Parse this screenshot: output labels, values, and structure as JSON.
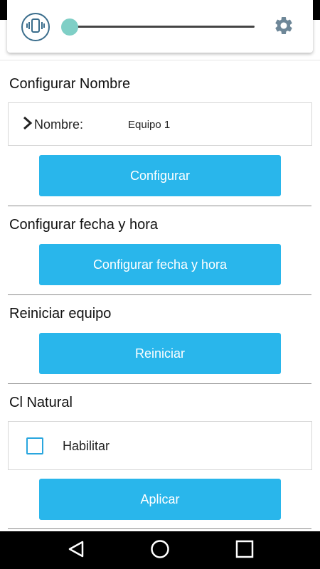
{
  "toolbar": {
    "volume": {
      "value": 0,
      "min": 0,
      "max": 100
    }
  },
  "sections": {
    "nombre": {
      "title": "Configurar Nombre",
      "field_label": "Nombre:",
      "field_value": "Equipo 1",
      "button_label": "Configurar"
    },
    "fecha": {
      "title": "Configurar fecha y hora",
      "button_label": "Configurar fecha y hora"
    },
    "reiniciar": {
      "title": "Reiniciar equipo",
      "button_label": "Reiniciar"
    },
    "cl_natural": {
      "title": "Cl Natural",
      "checkbox_label": "Habilitar",
      "checkbox_checked": false,
      "button_label": "Aplicar"
    }
  },
  "colors": {
    "accent": "#29b6eb",
    "slider": "#7fcfc6",
    "icon": "#3a6d8c",
    "gear": "#6e8798",
    "checkbox": "#29a6de"
  },
  "icons": {
    "vibrate": "vibrate-icon",
    "settings": "gear-icon",
    "chevron": "chevron-right-icon",
    "back": "back-triangle-icon",
    "home": "home-circle-icon",
    "recents": "recents-square-icon"
  }
}
